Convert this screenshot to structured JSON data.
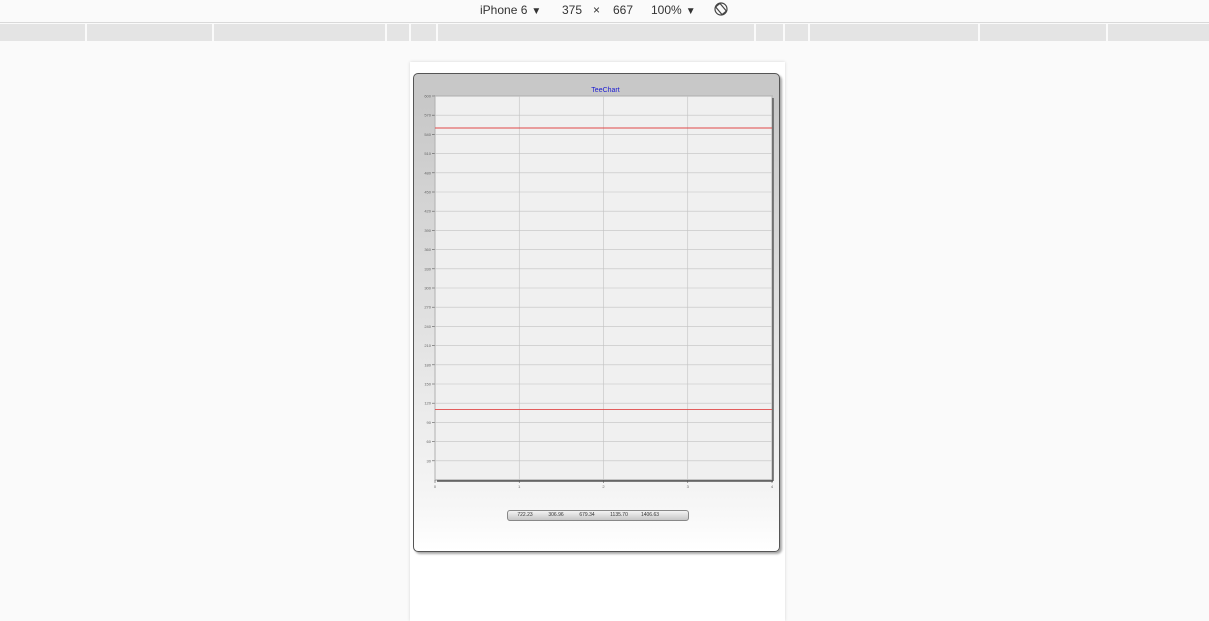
{
  "toolbar": {
    "device": "iPhone 6",
    "width": "375",
    "times": "×",
    "height": "667",
    "zoom": "100%",
    "caret": "▼"
  },
  "colors": {
    "title": "#1a1ad0",
    "line": "#e04848",
    "grid": "#c2c2c2"
  },
  "chart_data": {
    "type": "line",
    "title": "TeeChart",
    "xlabel": "",
    "ylabel": "",
    "xlim": [
      0,
      4
    ],
    "ylim": [
      0,
      600
    ],
    "yticks": [
      30,
      60,
      90,
      120,
      150,
      180,
      210,
      240,
      270,
      300,
      330,
      360,
      390,
      420,
      450,
      480,
      510,
      540,
      570,
      600
    ],
    "xticks": [
      0,
      1,
      2,
      3,
      4
    ],
    "grid": true,
    "series": [
      {
        "x": [
          0,
          1,
          2,
          3,
          4
        ],
        "values": [
          550,
          550,
          550,
          550,
          550
        ]
      },
      {
        "x": [
          0,
          1,
          2,
          3,
          4
        ],
        "values": [
          110,
          110,
          110,
          110,
          110
        ]
      }
    ]
  },
  "range_labels": [
    "722.23",
    "306.96",
    "679.34",
    "1135.70",
    "1406.63"
  ]
}
